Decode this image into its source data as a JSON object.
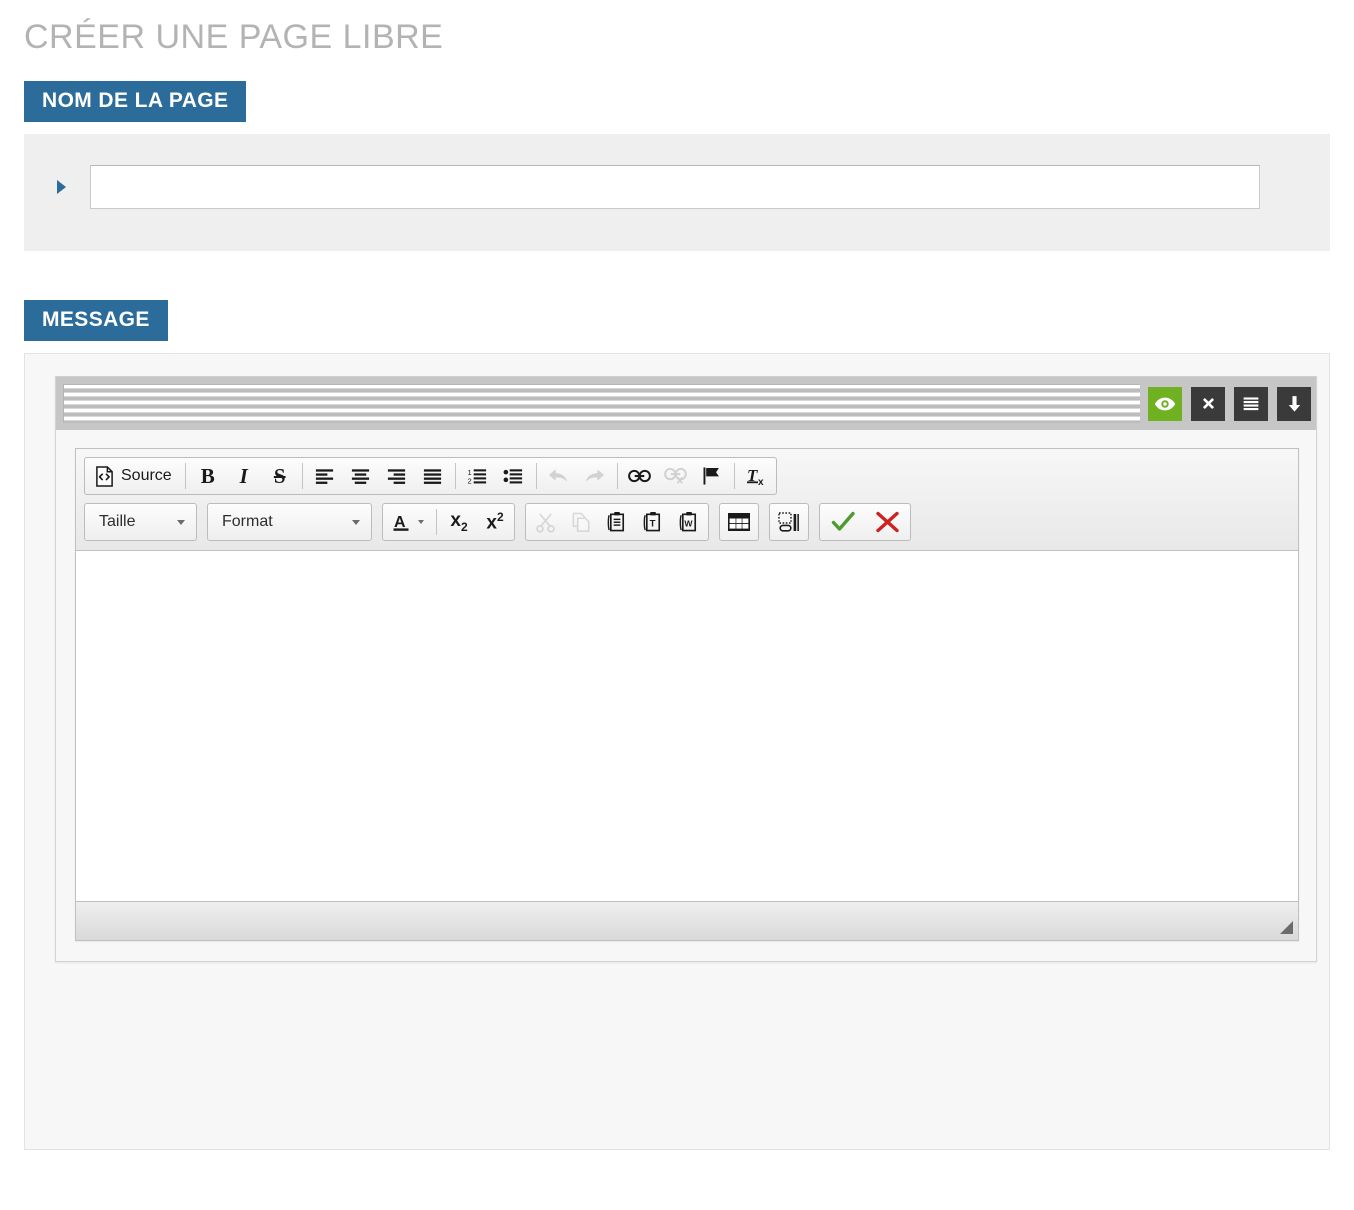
{
  "page": {
    "title": "CRÉER UNE PAGE LIBRE"
  },
  "sections": {
    "name": {
      "label": "NOM DE LA PAGE",
      "input_value": "",
      "input_placeholder": ""
    },
    "message": {
      "label": "MESSAGE"
    }
  },
  "colors": {
    "accent_blue": "#2b6c9b",
    "title_grey": "#b3b3b3",
    "panel_grey": "#efefef",
    "topbar_grey": "#c6c6c6",
    "action_dark": "#3a3a3a",
    "action_green": "#6fb121",
    "confirm_green": "#4e9a2f",
    "cancel_red": "#cc2222"
  },
  "editor_topbar": {
    "buttons": [
      {
        "name": "preview-icon",
        "title": "Aperçu",
        "style": "green"
      },
      {
        "name": "delete-icon",
        "title": "Supprimer",
        "style": "dark"
      },
      {
        "name": "menu-icon",
        "title": "Options",
        "style": "dark"
      },
      {
        "name": "move-down-icon",
        "title": "Descendre",
        "style": "dark"
      }
    ]
  },
  "toolbar": {
    "row1": {
      "source_label": "Source",
      "source_icon": "source-code-icon",
      "bold_label": "B",
      "italic_label": "I",
      "strike_label": "S",
      "align_left_icon": "align-left-icon",
      "align_center_icon": "align-center-icon",
      "align_right_icon": "align-right-icon",
      "align_justify_icon": "align-justify-icon",
      "numbered_list_icon": "numbered-list-icon",
      "bulleted_list_icon": "bulleted-list-icon",
      "undo_icon": "undo-icon",
      "redo_icon": "redo-icon",
      "link_icon": "link-icon",
      "unlink_icon": "unlink-icon",
      "anchor_icon": "anchor-flag-icon",
      "remove_format_label": "T",
      "remove_format_icon": "remove-format-icon"
    },
    "row2": {
      "size_label": "Taille",
      "format_label": "Format",
      "text_color_label": "A",
      "subscript_label": "x",
      "subscript_index": "2",
      "superscript_label": "x",
      "superscript_index": "2",
      "cut_icon": "cut-icon",
      "copy_icon": "copy-icon",
      "paste_icon": "paste-icon",
      "paste_text_icon": "paste-as-plain-text-icon",
      "paste_word_icon": "paste-from-word-icon",
      "table_icon": "table-icon",
      "show_blocks_icon": "show-blocks-icon",
      "confirm_icon": "confirm-check-icon",
      "cancel_icon": "cancel-cross-icon"
    }
  },
  "editor_body": {
    "content": ""
  }
}
